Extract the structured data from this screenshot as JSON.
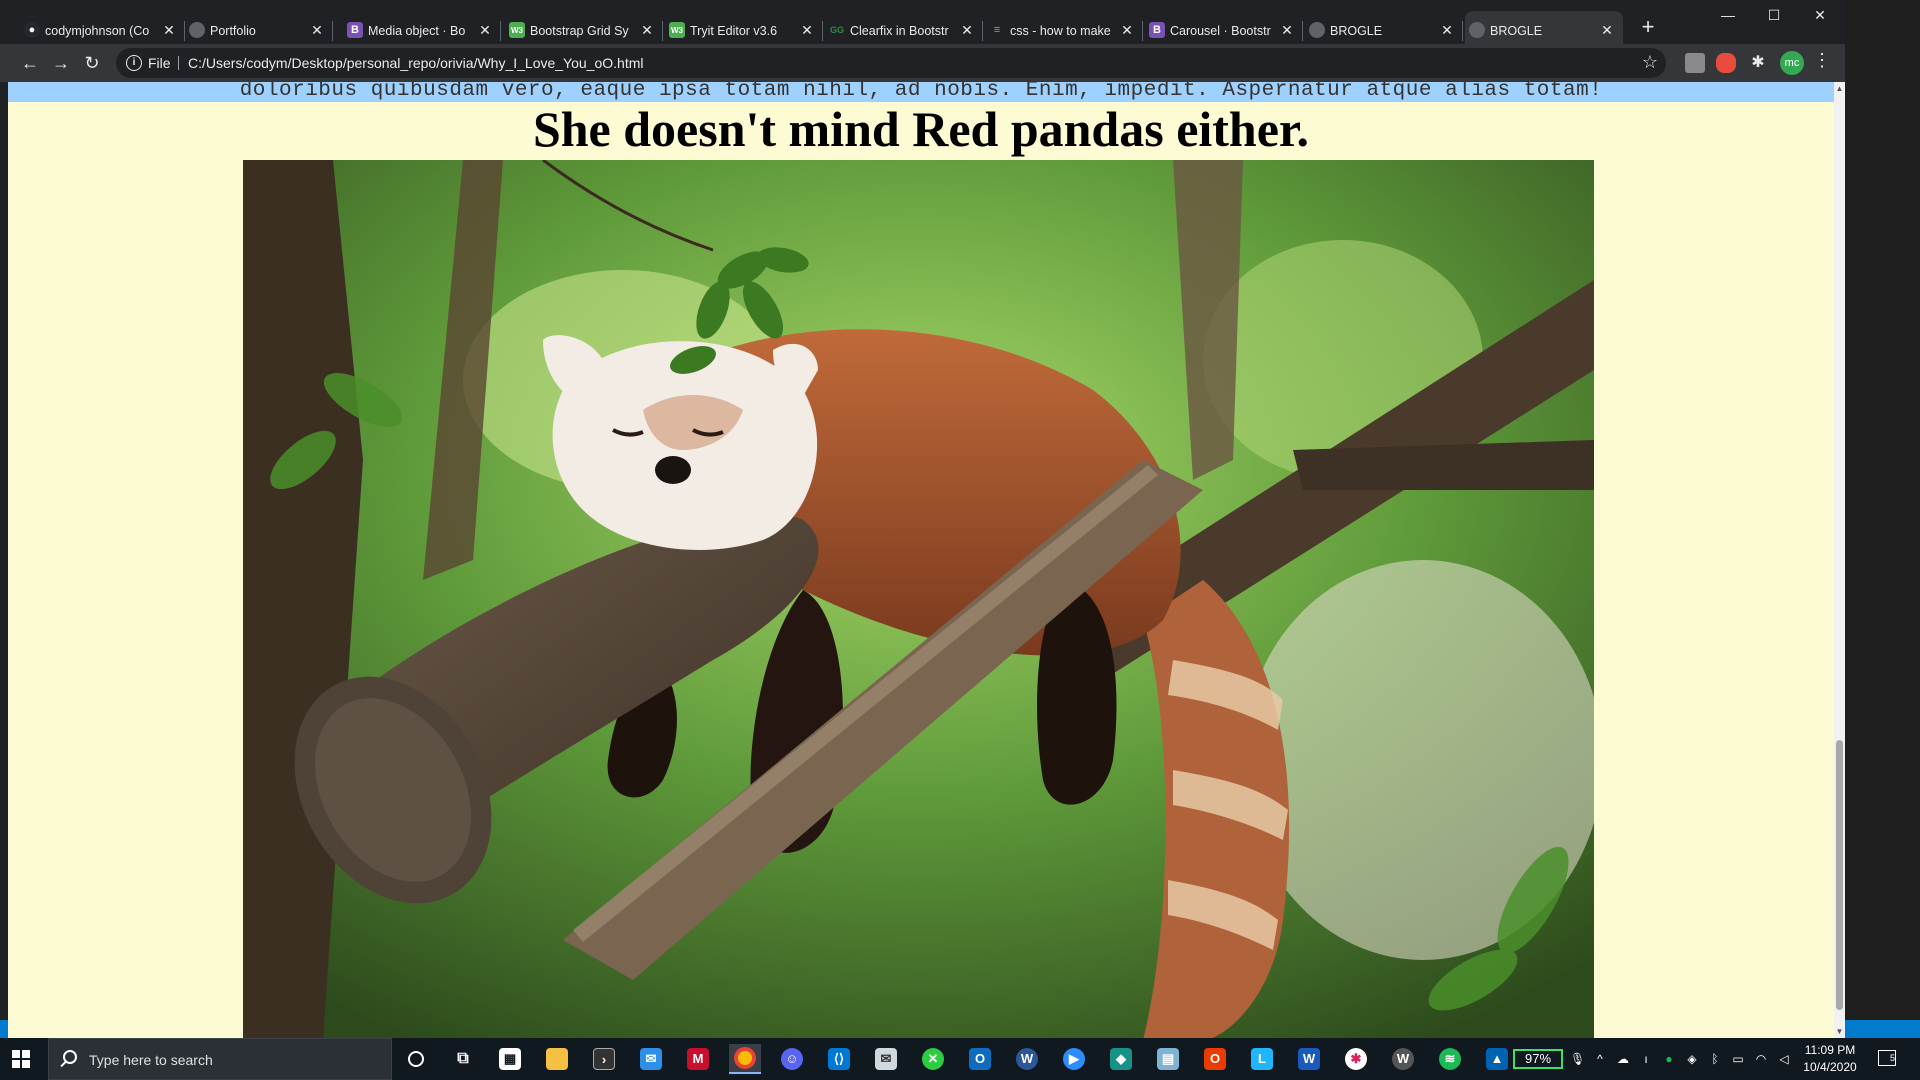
{
  "browser": {
    "tabs": [
      {
        "title": "codymjohnson (Co",
        "favicon": "github-icon",
        "color": "#24292e"
      },
      {
        "title": "Portfolio",
        "favicon": "globe-icon",
        "color": "#5f6368"
      },
      {
        "title": "Media object · Bo",
        "favicon": "bootstrap-icon",
        "color": "#7952b3"
      },
      {
        "title": "Bootstrap Grid Sy",
        "favicon": "w3schools-icon",
        "color": "#4caf50"
      },
      {
        "title": "Tryit Editor v3.6",
        "favicon": "w3schools-icon",
        "color": "#4caf50"
      },
      {
        "title": "Clearfix in Bootstr",
        "favicon": "geeks-icon",
        "color": "#2f8d46"
      },
      {
        "title": "css - how to make",
        "favicon": "stackoverflow-icon",
        "color": "#f48024"
      },
      {
        "title": "Carousel · Bootstr",
        "favicon": "bootstrap-icon",
        "color": "#7952b3"
      },
      {
        "title": "BROGLE",
        "favicon": "globe-icon",
        "color": "#5f6368"
      },
      {
        "title": "BROGLE",
        "favicon": "globe-icon",
        "color": "#5f6368"
      }
    ],
    "active_tab": 9,
    "new_tab": "+",
    "scheme": "File",
    "url": "C:/Users/codym/Desktop/personal_repo/orivia/Why_I_Love_You_oO.html",
    "profile_initials": "mc"
  },
  "page": {
    "lorem_text": "doloribus quibusdam vero, eaque ipsa totam nihil, ad nobis. Enim, impedit. Aspernatur atque alias totam!",
    "heading": "She doesn't mind Red pandas either.",
    "image_alt": "red panda sleeping on a tree branch"
  },
  "taskbar": {
    "search_placeholder": "Type here to search",
    "apps": [
      "cortana-icon",
      "task-view-icon",
      "store-icon",
      "file-explorer-icon",
      "terminal-icon",
      "mail-icon",
      "mcafee-icon",
      "chrome-icon",
      "discord-icon",
      "vscode-icon",
      "mail-app-icon",
      "xbox-icon",
      "outlook-icon",
      "w-app-icon",
      "zoom-icon",
      "gitkraken-icon",
      "notepad-icon",
      "office-icon",
      "l-app-icon",
      "word-icon",
      "slack-icon",
      "w-app-icon-2",
      "spotify-icon",
      "photos-icon"
    ],
    "battery": "97%",
    "time": "11:09 PM",
    "date": "10/4/2020",
    "notifications": "5"
  }
}
